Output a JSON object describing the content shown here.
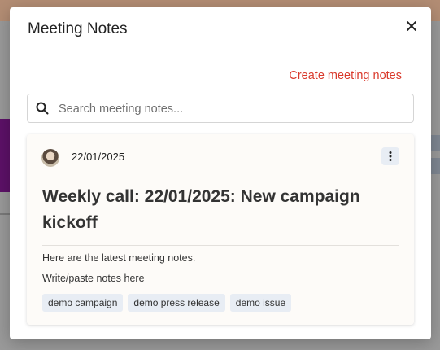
{
  "modal": {
    "title": "Meeting Notes",
    "create_link": "Create meeting notes",
    "search_placeholder": "Search meeting notes..."
  },
  "note": {
    "date": "22/01/2025",
    "title": "Weekly call: 22/01/2025: New campaign kickoff",
    "lines": [
      "Here are the latest meeting notes.",
      "Write/paste notes here"
    ],
    "tags": [
      "demo campaign",
      "demo press release",
      "demo issue"
    ]
  },
  "icons": {
    "close": "close-icon",
    "search": "search-icon",
    "menu": "more-vertical-icon"
  },
  "colors": {
    "accent": "#d9392b",
    "tag_bg": "#e8edf4"
  }
}
